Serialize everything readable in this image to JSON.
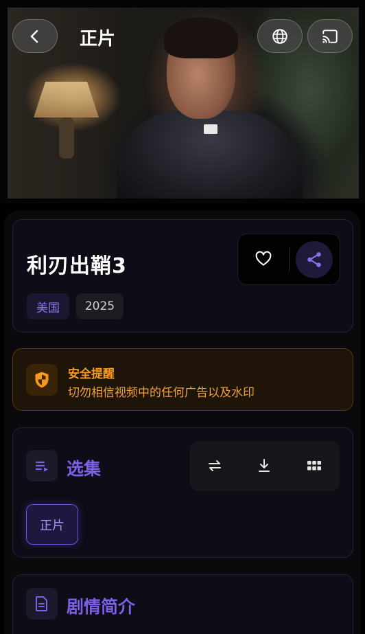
{
  "player": {
    "title": "正片",
    "buttons": {
      "back": "chevron-left-icon",
      "language": "globe-icon",
      "cast": "cast-icon"
    }
  },
  "movie": {
    "title": "利刃出鞘3",
    "tags": {
      "country": "美国",
      "year": "2025"
    },
    "actions": {
      "favorite": "heart-icon",
      "share": "share-icon"
    }
  },
  "notice": {
    "title": "安全提醒",
    "text": "切勿相信视频中的任何广告以及水印",
    "icon": "shield-icon"
  },
  "episodes": {
    "section_title": "选集",
    "icon": "playlist-icon",
    "tools": [
      "swap-icon",
      "download-icon",
      "grid-icon"
    ],
    "items": [
      {
        "label": "正片",
        "selected": true
      }
    ]
  },
  "synopsis": {
    "section_title": "剧情简介",
    "icon": "document-icon"
  },
  "colors": {
    "accent": "#7d5fe8",
    "warning": "#f59a1e",
    "background": "#000000",
    "card": "#0d0c17"
  }
}
